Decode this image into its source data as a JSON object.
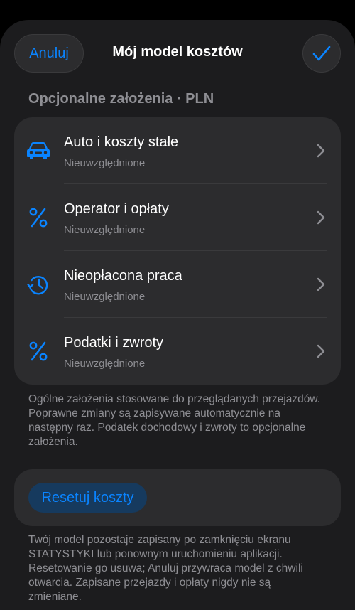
{
  "header": {
    "cancel_label": "Anuluj",
    "title": "Mój model kosztów",
    "confirm_icon": "checkmark-icon"
  },
  "section": {
    "title": "Opcjonalne założenia · PLN",
    "items": [
      {
        "label": "Auto i koszty stałe",
        "status": "Nieuwzględnione",
        "icon": "car-icon"
      },
      {
        "label": "Operator i opłaty",
        "status": "Nieuwzględnione",
        "icon": "percent-icon"
      },
      {
        "label": "Nieopłacona praca",
        "status": "Nieuwzględnione",
        "icon": "history-clock-icon"
      },
      {
        "label": "Podatki i zwroty",
        "status": "Nieuwzględnione",
        "icon": "percent-icon"
      }
    ],
    "footnote": "Ogólne założenia stosowane do przeglądanych przejazdów. Poprawne zmiany są zapisywane automatycznie na następny raz. Podatek dochodowy i zwroty to opcjonalne założenia."
  },
  "reset": {
    "button_label": "Resetuj koszty",
    "footnote": "Twój model pozostaje zapisany po zamknięciu ekranu STATYSTYKI lub ponownym uruchomieniu aplikacji. Resetowanie go usuwa; Anuluj przywraca model z chwili otwarcia. Zapisane przejazdy i opłaty nigdy nie są zmieniane."
  },
  "colors": {
    "accent": "#0a84ff",
    "background": "#1c1c1e",
    "card": "#2c2c2e",
    "secondary_text": "#8e8e93"
  }
}
